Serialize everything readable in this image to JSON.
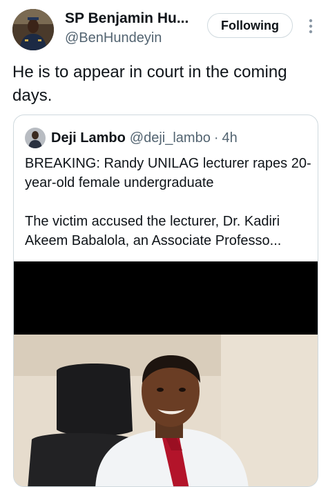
{
  "tweet": {
    "author_name": "SP Benjamin Hu...",
    "author_handle": "@BenHundeyin",
    "follow_label": "Following",
    "text": "He is to appear in court in the coming days."
  },
  "quote": {
    "author_name": "Deji Lambo",
    "author_handle": "@deji_lambo",
    "separator": "·",
    "time": "4h",
    "paragraph1": "BREAKING: Randy UNILAG lecturer rapes 20-year-old female undergraduate",
    "paragraph2": "The victim accused the lecturer, Dr. Kadiri Akeem Babalola, an Associate Professo..."
  },
  "icons": {
    "more": "more-vertical-icon"
  },
  "colors": {
    "text_primary": "#0f1419",
    "text_secondary": "#536471",
    "border": "#cfd9de",
    "letterbox": "#000000"
  }
}
